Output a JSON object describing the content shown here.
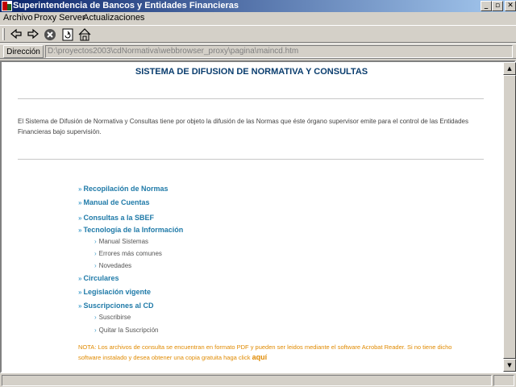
{
  "window": {
    "title": "Superintendencia de Bancos y Entidades Financieras",
    "minimize": "_",
    "maximize": "▫",
    "close": "✕"
  },
  "menu": {
    "items": [
      "Archivo",
      "Proxy Server",
      "Actualizaciones"
    ]
  },
  "toolbar": {
    "icons": [
      "back-arrow-icon",
      "forward-arrow-icon",
      "stop-icon",
      "refresh-icon",
      "home-icon"
    ]
  },
  "address": {
    "label": "Dirección",
    "value": "D:\\proyectos2003\\cdNormativa\\webbrowser_proxy\\pagina\\maincd.htm"
  },
  "page": {
    "title": "SISTEMA DE DIFUSION DE NORMATIVA Y CONSULTAS",
    "intro": "El Sistema de Difusión de Normativa y Consultas tiene por objeto la difusión de las Normas que éste órgano supervisor emite para el control de las Entidades Financieras bajo supervisión.",
    "arrow": "»",
    "sub_arrow": "›",
    "links": {
      "recopilacion": "Recopilación de Normas",
      "manual_cuentas": "Manual de Cuentas",
      "consultas": "Consultas a la SBEF",
      "tecnologia": "Tecnología de la Información",
      "manual_sistemas": "Manual Sistemas",
      "errores": "Errores más comunes",
      "novedades": "Novedades",
      "circulares": "Circulares",
      "legislacion": "Legislación vigente",
      "suscripciones": "Suscripciones al CD",
      "suscribirse": "Suscribirse",
      "quitar": "Quitar la Suscripción"
    },
    "note": "NOTA: Los archivos de consulta se encuentran en formato PDF y pueden ser leidos mediante el software Acrobat Reader. Si no tiene dicho software instalado y desea obtener una copia gratuita haga click",
    "note_link": "aquí"
  },
  "scrollbar": {
    "up": "▲",
    "down": "▼"
  },
  "colors": {
    "titlebar": "#0a246a",
    "heading": "#0a3d6e",
    "link": "#1f7aa8",
    "note": "#e08a00"
  }
}
